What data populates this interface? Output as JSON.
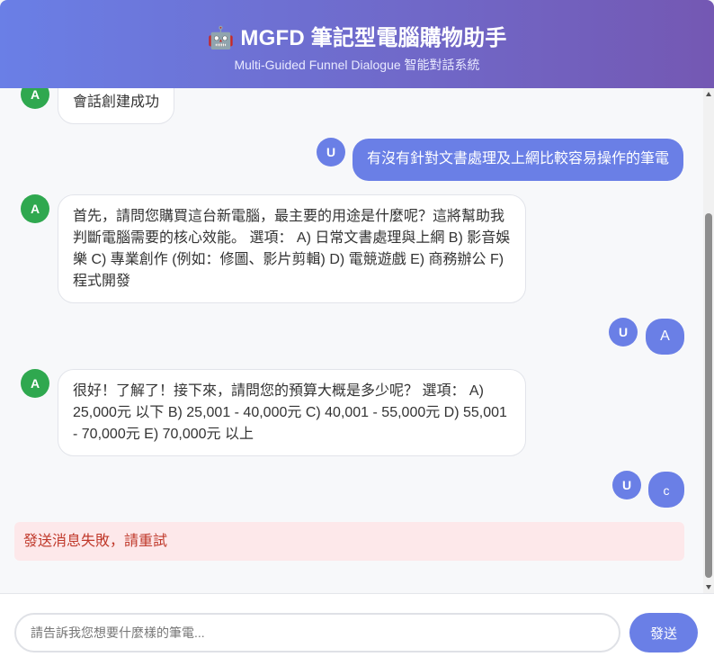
{
  "header": {
    "title": "🤖 MGFD 筆記型電腦購物助手",
    "subtitle": "Multi-Guided Funnel Dialogue 智能對話系統"
  },
  "messages": [
    {
      "role": "assistant",
      "avatar": "A",
      "text": "會話創建成功"
    },
    {
      "role": "user",
      "avatar": "U",
      "text": "有沒有針對文書處理及上網比較容易操作的筆電"
    },
    {
      "role": "assistant",
      "avatar": "A",
      "lines": [
        "首先，請問您購買這台新電腦，最主要的用途是什麼呢？這將幫助我",
        "判斷電腦需要的核心效能。 選項： A) 日常文書處理與上網 B) 影音娛",
        "樂 C) 專業創作 (例如：修圖、影片剪輯) D) 電競遊戲 E) 商務辦公 F)",
        "程式開發"
      ]
    },
    {
      "role": "user",
      "avatar": "U",
      "text": "A"
    },
    {
      "role": "assistant",
      "avatar": "A",
      "lines": [
        "很好！了解了！接下來，請問您的預算大概是多少呢？ 選項： A)",
        "25,000元 以下 B) 25,001 - 40,000元 C) 40,001 - 55,000元 D) 55,001",
        "- 70,000元 E) 70,000元 以上"
      ]
    },
    {
      "role": "user",
      "avatar": "U",
      "text": "c"
    }
  ],
  "error": "發送消息失敗，請重試",
  "input": {
    "placeholder": "請告訴我您想要什麼樣的筆電...",
    "value": ""
  },
  "send_label": "發送",
  "colors": {
    "accent": "#6a7fe6",
    "header_end": "#7458b3",
    "assistant_avatar": "#2fa84f",
    "error_bg": "#fde8ea",
    "error_text": "#c0392b"
  }
}
